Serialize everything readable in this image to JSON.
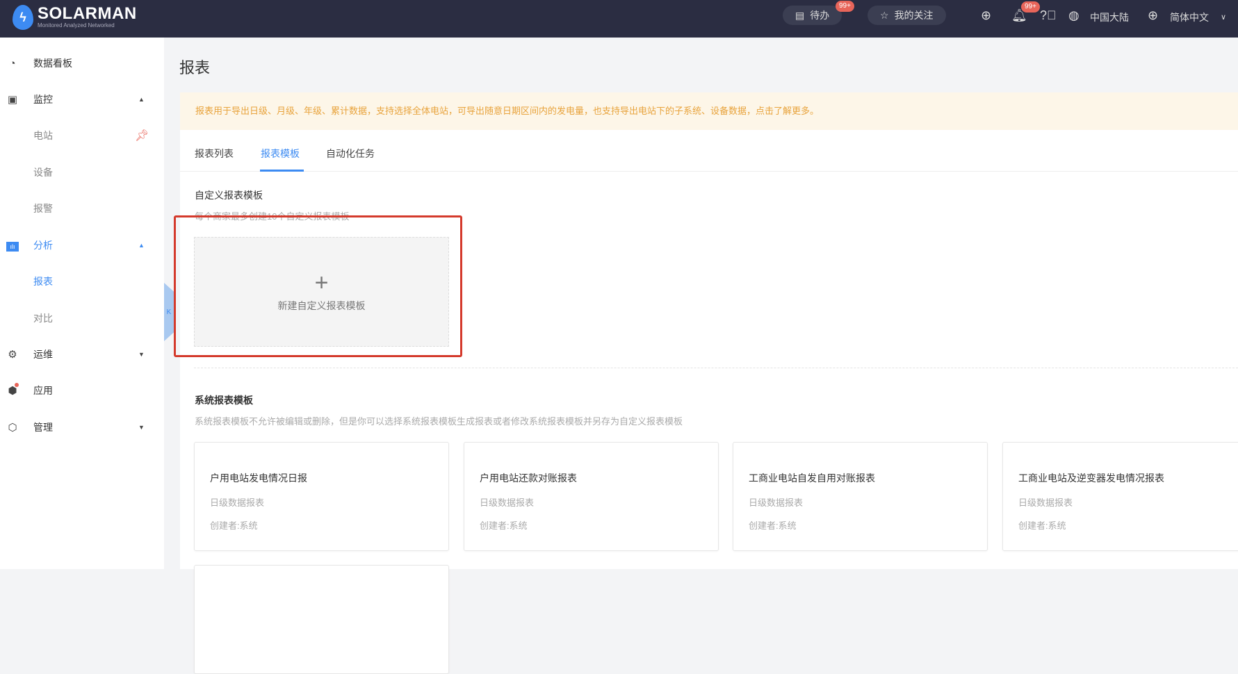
{
  "header": {
    "brand": "SOLARMAN",
    "tagline": "Monitored Analyzed Networked",
    "todo_label": "待办",
    "todo_badge": "99+",
    "favorites_label": "我的关注",
    "notif_badge": "99+",
    "region": "中国大陆",
    "language": "简体中文"
  },
  "sidebar": {
    "items": [
      {
        "label": "数据看板",
        "icon": "dashboard-icon"
      },
      {
        "label": "监控",
        "icon": "monitor-icon",
        "arrow": "▲"
      },
      {
        "label": "电站"
      },
      {
        "label": "设备"
      },
      {
        "label": "报警"
      },
      {
        "label": "分析",
        "icon": "chart-icon",
        "arrow": "▲"
      },
      {
        "label": "报表"
      },
      {
        "label": "对比"
      },
      {
        "label": "运维",
        "icon": "gear-icon",
        "arrow": "▼"
      },
      {
        "label": "应用",
        "icon": "cube-icon"
      },
      {
        "label": "管理",
        "icon": "hexagon-icon",
        "arrow": "▼"
      }
    ]
  },
  "page": {
    "title": "报表",
    "notice": "报表用于导出日级、月级、年级、累计数据，支持选择全体电站，可导出随意日期区间内的发电量，也支持导出电站下的子系统、设备数据，点击了解更多。",
    "tabs": [
      "报表列表",
      "报表模板",
      "自动化任务"
    ],
    "custom": {
      "title": "自定义报表模板",
      "subtitle": "每个商家最多创建10个自定义报表模板",
      "new_label": "新建自定义报表模板"
    },
    "system": {
      "title": "系统报表模板",
      "subtitle": "系统报表模板不允许被编辑或删除，但是你可以选择系统报表模板生成报表或者修改系统报表模板并另存为自定义报表模板",
      "cards": [
        {
          "title": "户用电站发电情况日报",
          "type": "日级数据报表",
          "creator": "创建者:系统"
        },
        {
          "title": "户用电站还款对账报表",
          "type": "日级数据报表",
          "creator": "创建者:系统"
        },
        {
          "title": "工商业电站自发自用对账报表",
          "type": "日级数据报表",
          "creator": "创建者:系统"
        },
        {
          "title": "工商业电站及逆变器发电情况报表",
          "type": "日级数据报表",
          "creator": "创建者:系统"
        }
      ]
    }
  },
  "colors": {
    "accent": "#3d8bf2",
    "header_bg": "#2b2d42",
    "highlight": "#d43a2c",
    "notice": "#e8a33c"
  }
}
